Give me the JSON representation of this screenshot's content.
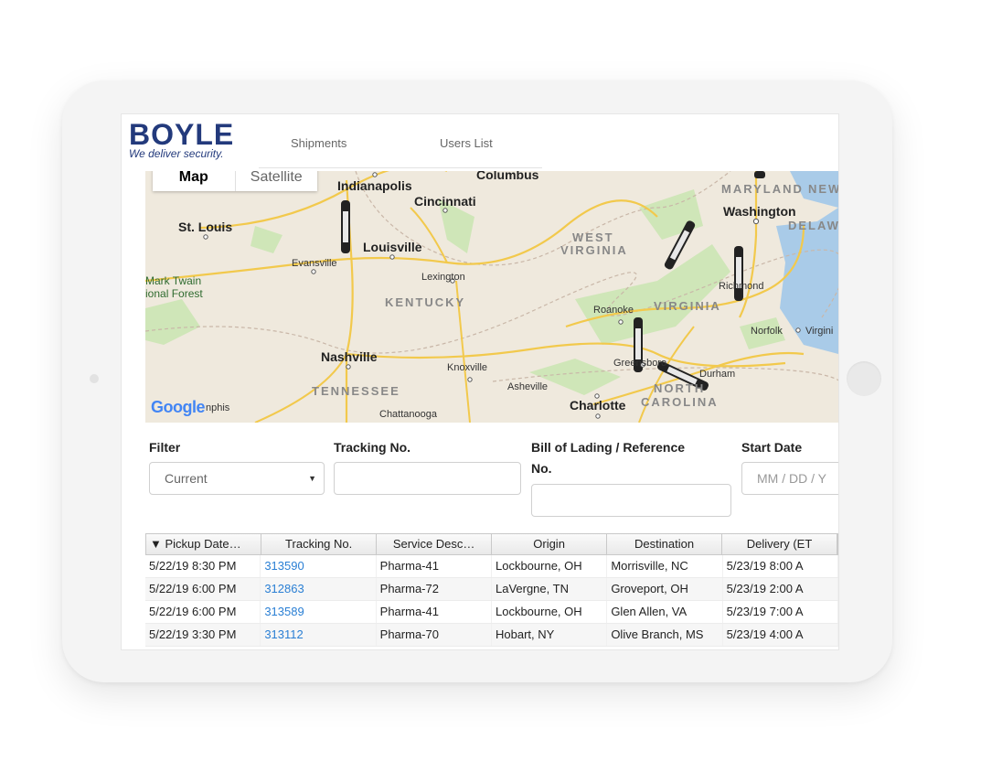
{
  "brand": {
    "name": "BOYLE",
    "tagline": "We deliver security."
  },
  "nav": {
    "shipments": "Shipments",
    "users": "Users List"
  },
  "map": {
    "toggle": {
      "map": "Map",
      "satellite": "Satellite"
    },
    "attribution": "Google",
    "places": [
      {
        "id": "indianapolis",
        "label": "Indianapolis"
      },
      {
        "id": "columbus",
        "label": "Columbus"
      },
      {
        "id": "cincinnati",
        "label": "Cincinnati"
      },
      {
        "id": "st-louis",
        "label": "St. Louis"
      },
      {
        "id": "louisville",
        "label": "Louisville"
      },
      {
        "id": "evansville",
        "label": "Evansville"
      },
      {
        "id": "lexington",
        "label": "Lexington"
      },
      {
        "id": "mark-twain",
        "label": "Mark Twain"
      },
      {
        "id": "national-forest",
        "label": "ional Forest"
      },
      {
        "id": "kentucky",
        "label": "KENTUCKY"
      },
      {
        "id": "west",
        "label": "WEST"
      },
      {
        "id": "virginia-w",
        "label": "VIRGINIA"
      },
      {
        "id": "maryland",
        "label": "MARYLAND"
      },
      {
        "id": "ne",
        "label": "NEW"
      },
      {
        "id": "washington",
        "label": "Washington"
      },
      {
        "id": "delaware",
        "label": "DELAW"
      },
      {
        "id": "richmond",
        "label": "Richmond"
      },
      {
        "id": "virginia",
        "label": "VIRGINIA"
      },
      {
        "id": "roanoke",
        "label": "Roanoke"
      },
      {
        "id": "norfolk",
        "label": "Norfolk"
      },
      {
        "id": "virginia-beach",
        "label": "Virgini"
      },
      {
        "id": "nashville",
        "label": "Nashville"
      },
      {
        "id": "knoxville",
        "label": "Knoxville"
      },
      {
        "id": "greensboro",
        "label": "Greensboro"
      },
      {
        "id": "durham",
        "label": "Durham"
      },
      {
        "id": "tennessee",
        "label": "TENNESSEE"
      },
      {
        "id": "asheville",
        "label": "Asheville"
      },
      {
        "id": "charlotte",
        "label": "Charlotte"
      },
      {
        "id": "north",
        "label": "NORTH"
      },
      {
        "id": "carolina",
        "label": "CAROLINA"
      },
      {
        "id": "chattanooga",
        "label": "Chattanooga"
      },
      {
        "id": "memphis",
        "label": "nphis"
      }
    ],
    "tracker_label": "BOYLE"
  },
  "filters": {
    "filter": {
      "label": "Filter",
      "value": "Current"
    },
    "tracking": {
      "label": "Tracking No.",
      "value": ""
    },
    "bol": {
      "label_line1": "Bill of Lading / Reference",
      "label_line2": "No.",
      "value": ""
    },
    "start_date": {
      "label": "Start Date",
      "placeholder": "MM / DD / Y"
    }
  },
  "table": {
    "headers": [
      "▼ Pickup Date…",
      "Tracking No.",
      "Service Desc…",
      "Origin",
      "Destination",
      "Delivery (ET"
    ],
    "rows": [
      [
        "5/22/19 8:30 PM",
        "313590",
        "Pharma-41",
        "Lockbourne, OH",
        "Morrisville, NC",
        "5/23/19 8:00 A"
      ],
      [
        "5/22/19 6:00 PM",
        "312863",
        "Pharma-72",
        "LaVergne, TN",
        "Groveport, OH",
        "5/23/19 2:00 A"
      ],
      [
        "5/22/19 6:00 PM",
        "313589",
        "Pharma-41",
        "Lockbourne, OH",
        "Glen Allen, VA",
        "5/23/19 7:00 A"
      ],
      [
        "5/22/19 3:30 PM",
        "313112",
        "Pharma-70",
        "Hobart, NY",
        "Olive Branch, MS",
        "5/23/19 4:00 A"
      ]
    ]
  },
  "colors": {
    "brand": "#233a7c",
    "link": "#2a7fd4",
    "map_land": "#efe9dd",
    "map_green": "#cfe6b8",
    "road": "#f7d77a",
    "water": "#a9cbe8"
  }
}
